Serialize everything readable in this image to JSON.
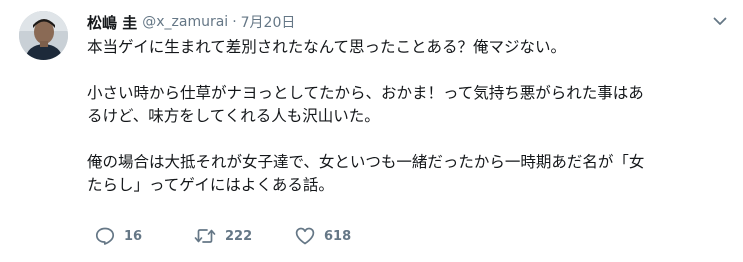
{
  "tweet": {
    "author": {
      "display_name": "松嶋 圭",
      "username": "@x_zamurai"
    },
    "separator": "·",
    "timestamp": "7月20日",
    "body": {
      "para1_line1": "本当ゲイに生まれて差別されたなんて思ったことある？俺マジない。",
      "para2_line1": "小さい時から仕草がナヨっとしてたから、おかま！って気持ち悪がられた事はあ",
      "para2_line2": "るけど、味方をしてくれる人も沢山いた。",
      "para3_line1": "俺の場合は大抵それが女子達で、女といつも一緒だったから一時期あだ名が「女",
      "para3_line2": "たらし」ってゲイにはよくある話。"
    },
    "actions": {
      "reply_count": "16",
      "retweet_count": "222",
      "like_count": "618"
    },
    "icons": {
      "reply": "reply-icon",
      "retweet": "retweet-icon",
      "like": "heart-icon",
      "more": "chevron-down-icon"
    },
    "colors": {
      "text": "#14171a",
      "secondary": "#657786",
      "background": "#ffffff"
    }
  }
}
